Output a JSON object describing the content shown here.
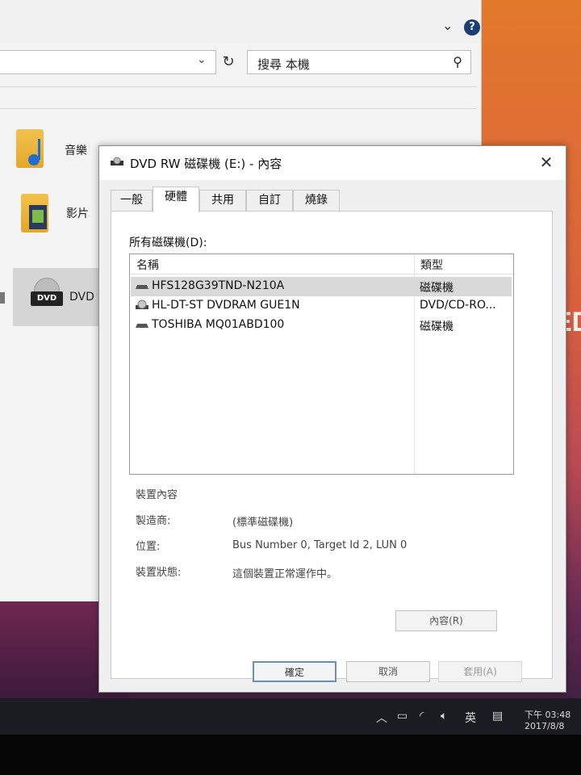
{
  "explorer": {
    "search_placeholder": "搜尋 本機",
    "help_icon": "?",
    "folders": [
      {
        "label": "音樂",
        "icon": "music-folder-icon"
      },
      {
        "label": "影片",
        "icon": "video-folder-icon"
      }
    ],
    "dvd_badge": "DVD",
    "dvd_label": "DVD R"
  },
  "background_text": "ED",
  "dialog": {
    "title": "DVD RW 磁碟機 (E:) - 內容",
    "tabs": [
      "一般",
      "硬體",
      "共用",
      "自訂",
      "燒錄"
    ],
    "active_tab": "硬體",
    "all_drives_label": "所有磁碟機(D):",
    "columns": {
      "name": "名稱",
      "type": "類型"
    },
    "drives": [
      {
        "name": "HFS128G39TND-N210A",
        "type": "磁碟機",
        "icon": "disk-drive-icon",
        "selected": true
      },
      {
        "name": "HL-DT-ST DVDRAM GUE1N",
        "type": "DVD/CD-RO...",
        "icon": "optical-drive-icon",
        "selected": false
      },
      {
        "name": "TOSHIBA MQ01ABD100",
        "type": "磁碟機",
        "icon": "disk-drive-icon",
        "selected": false
      }
    ],
    "device_properties": {
      "heading": "裝置內容",
      "manufacturer_label": "製造商:",
      "manufacturer_value": "(標準磁碟機)",
      "location_label": "位置:",
      "location_value": "Bus Number 0, Target Id 2, LUN 0",
      "status_label": "裝置狀態:",
      "status_value": "這個裝置正常運作中。"
    },
    "properties_button": "內容(R)",
    "ok_button": "確定",
    "cancel_button": "取消",
    "apply_button": "套用(A)"
  },
  "taskbar": {
    "ime": "英",
    "time": "下午 03:48",
    "date": "2017/8/8"
  }
}
